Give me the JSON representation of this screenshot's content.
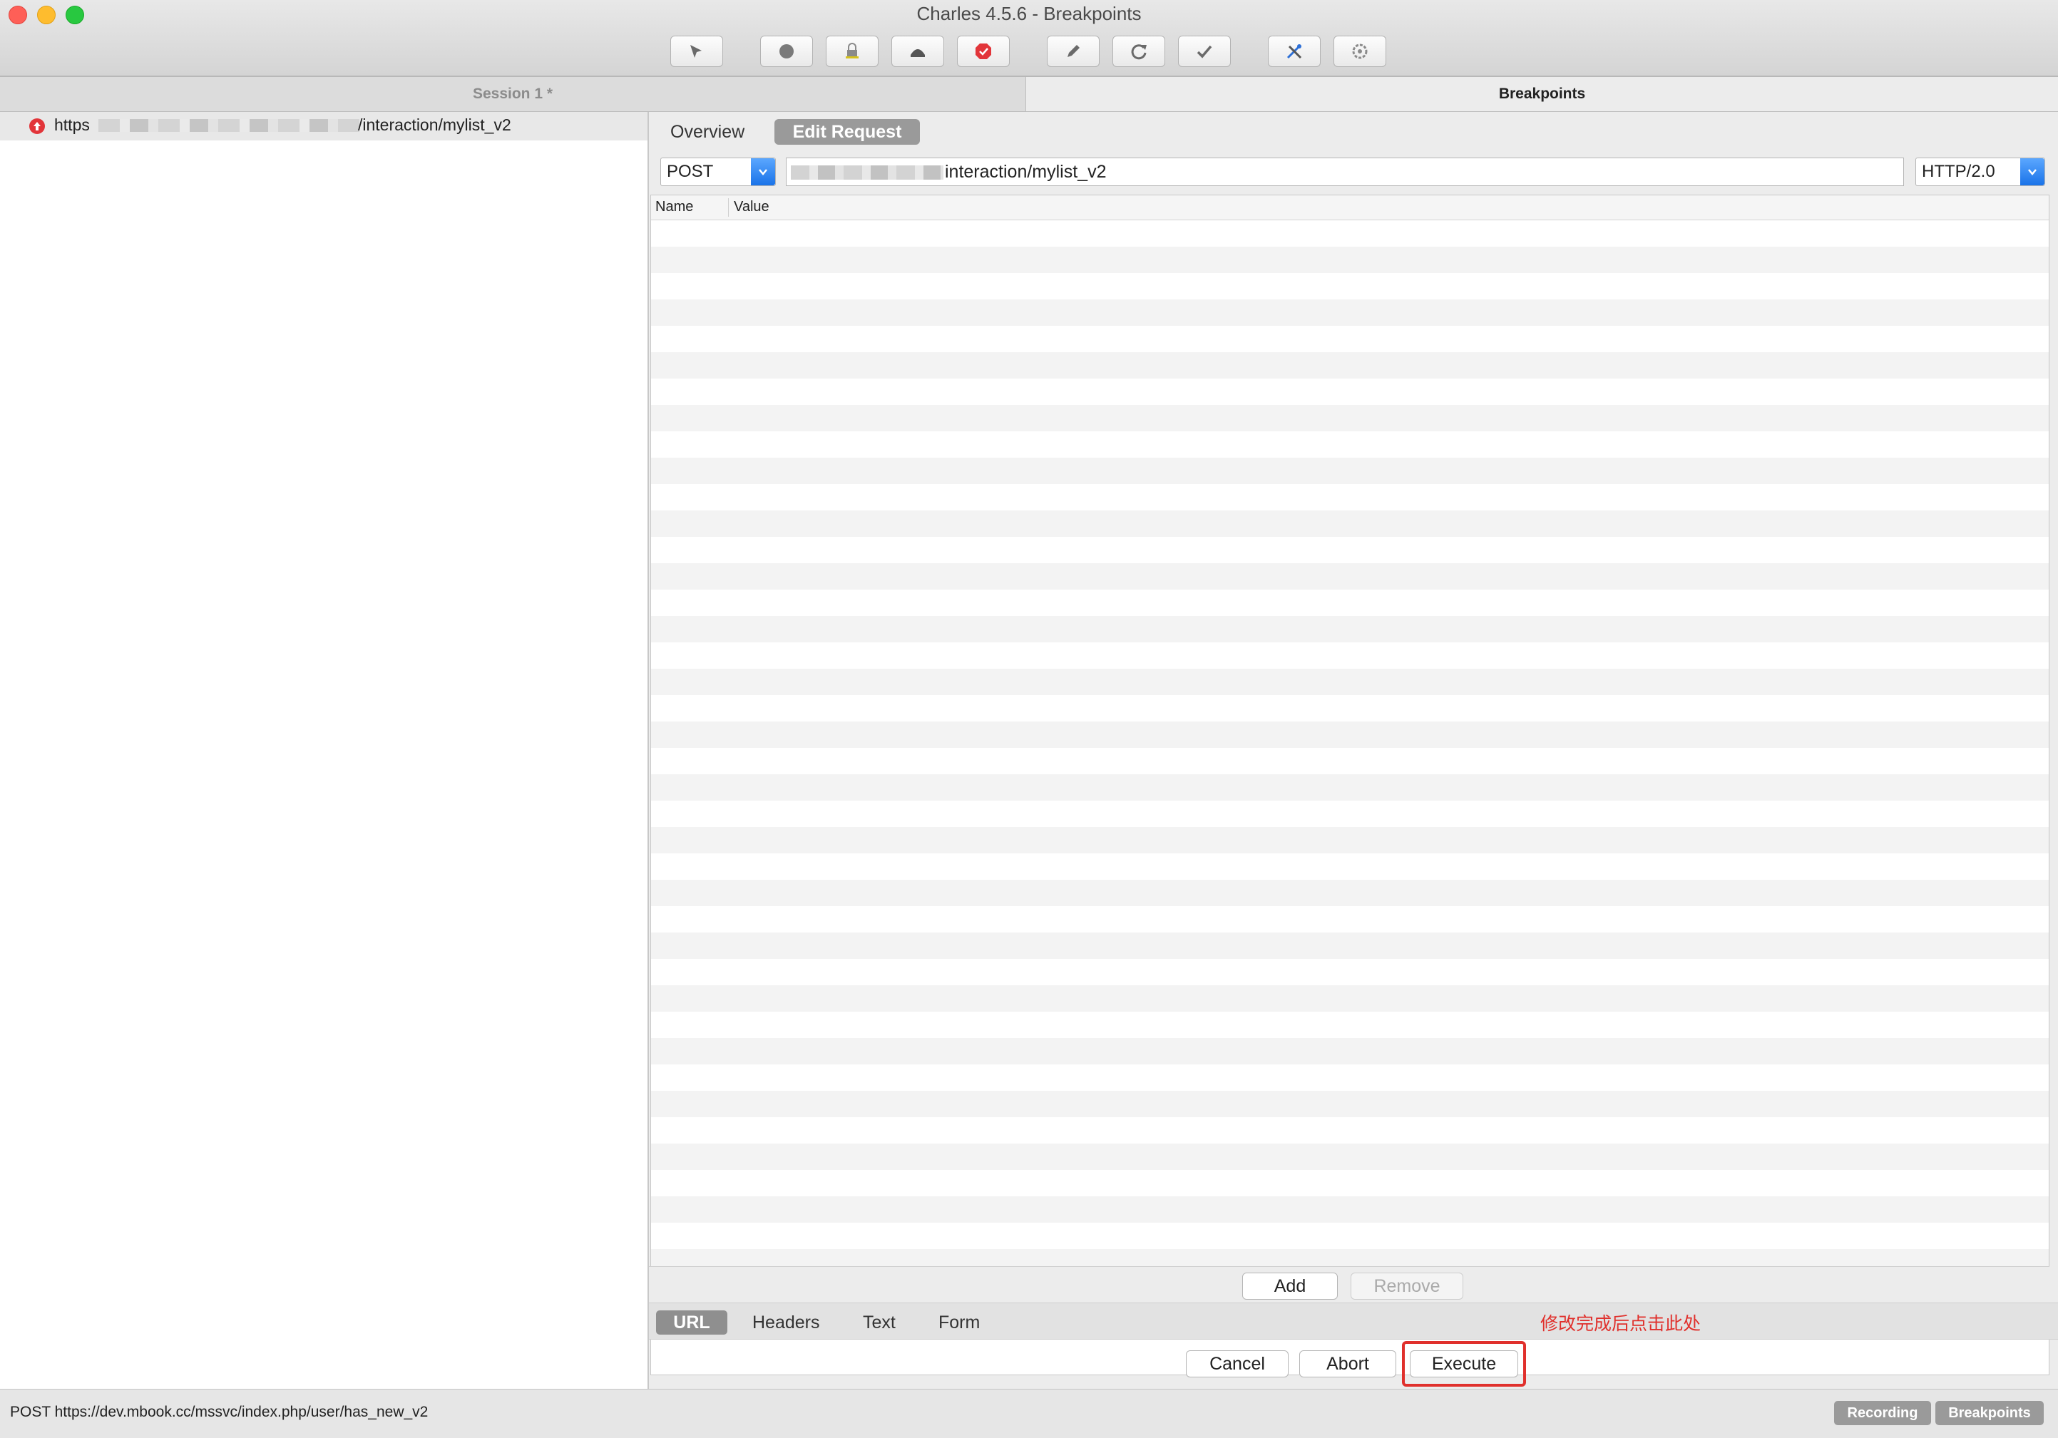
{
  "window": {
    "title": "Charles 4.5.6 - Breakpoints"
  },
  "toolbar": {
    "buttons": [
      {
        "icon": "broom-icon"
      },
      {
        "icon": "record-icon"
      },
      {
        "icon": "ssl-proxy-icon"
      },
      {
        "icon": "throttle-icon"
      },
      {
        "icon": "breakpoints-icon"
      },
      {
        "icon": "compose-icon"
      },
      {
        "icon": "repeat-icon"
      },
      {
        "icon": "validate-icon"
      },
      {
        "icon": "tools-icon"
      },
      {
        "icon": "settings-icon"
      }
    ]
  },
  "tabs": {
    "session": "Session 1 *",
    "breakpoints": "Breakpoints"
  },
  "left_panel": {
    "request": {
      "url_prefix": "https",
      "url_suffix": "/interaction/mylist_v2",
      "icon": "upload-arrow-icon"
    }
  },
  "editor": {
    "tabs": {
      "overview": "Overview",
      "edit_request": "Edit Request"
    },
    "method": "POST",
    "url": "interaction/mylist_v2",
    "protocol": "HTTP/2.0",
    "table": {
      "columns": [
        "Name",
        "Value"
      ]
    },
    "add_label": "Add",
    "remove_label": "Remove",
    "view_tabs": [
      "URL",
      "Headers",
      "Text",
      "Form"
    ],
    "annotation": "修改完成后点击此处",
    "actions": {
      "cancel": "Cancel",
      "abort": "Abort",
      "execute": "Execute"
    }
  },
  "status_bar": {
    "text": "POST https://dev.mbook.cc/mssvc/index.php/user/has_new_v2",
    "recording": "Recording",
    "breakpoints": "Breakpoints"
  },
  "colors": {
    "accent_blue": "#1a73e8",
    "annotation_red": "#e0302c",
    "breakpoint_red": "#e2353a"
  }
}
